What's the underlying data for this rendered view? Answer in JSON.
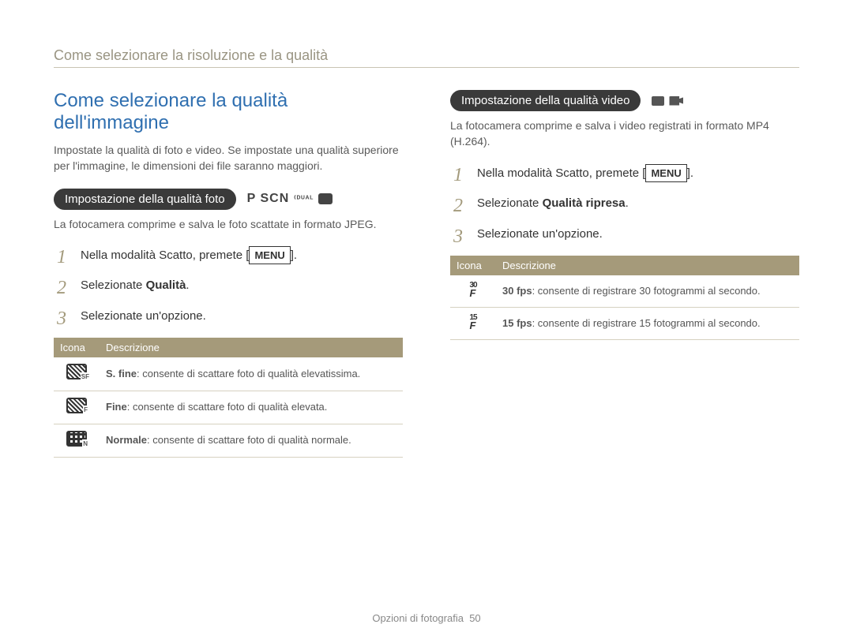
{
  "breadcrumb": "Come selezionare la risoluzione e la qualità",
  "main_title": "Come selezionare la qualità dell'immagine",
  "intro": "Impostate la qualità di foto e video. Se impostate una qualità superiore per l'immagine, le dimensioni dei file saranno maggiori.",
  "photo": {
    "pill": "Impostazione della qualità foto",
    "modes": "P SCN",
    "desc": "La fotocamera comprime e salva le foto scattate in formato JPEG.",
    "step1_a": "Nella modalità Scatto, premete [",
    "step1_menu": "MENU",
    "step1_b": "].",
    "step2_a": "Selezionate ",
    "step2_b": "Qualità",
    "step2_c": ".",
    "step3": "Selezionate un'opzione.",
    "table": {
      "h1": "Icona",
      "h2": "Descrizione",
      "rows": [
        {
          "bold": "S. fine",
          "rest": ": consente di scattare foto di qualità elevatissima."
        },
        {
          "bold": "Fine",
          "rest": ": consente di scattare foto di qualità elevata."
        },
        {
          "bold": "Normale",
          "rest": ": consente di scattare foto di qualità normale."
        }
      ]
    }
  },
  "video": {
    "pill": "Impostazione della qualità video",
    "desc": "La fotocamera comprime e salva i video registrati in formato MP4 (H.264).",
    "step1_a": "Nella modalità Scatto, premete [",
    "step1_menu": "MENU",
    "step1_b": "].",
    "step2_a": "Selezionate ",
    "step2_b": "Qualità ripresa",
    "step2_c": ".",
    "step3": "Selezionate un'opzione.",
    "table": {
      "h1": "Icona",
      "h2": "Descrizione",
      "rows": [
        {
          "fps": "30",
          "bold": "30 fps",
          "rest": ": consente di registrare 30 fotogrammi al secondo."
        },
        {
          "fps": "15",
          "bold": "15 fps",
          "rest": ": consente di registrare 15 fotogrammi al secondo."
        }
      ]
    }
  },
  "footer_label": "Opzioni di fotografia",
  "footer_page": "50"
}
